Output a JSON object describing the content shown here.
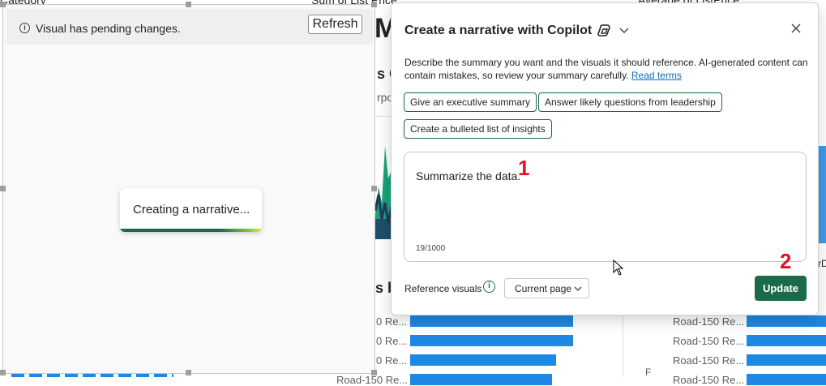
{
  "background": {
    "top_labels": [
      "Category",
      "Sum of List Price",
      "Average of ListPrice"
    ],
    "big_letter": "M",
    "card_title_fragments": [
      "s O",
      "s b"
    ],
    "card_sub_fragments": [
      "rpo",
      "rD"
    ],
    "bar_labels_left": [
      "0 Re...",
      "0 Re...",
      "0 Re...",
      "Road-150 Re..."
    ],
    "bar_labels_right": [
      "Road-150 Re...",
      "Road-150 Re...",
      "Road-150 Re...",
      "Road-150 Re..."
    ],
    "accent_bar_color": "#1e88e5"
  },
  "visual": {
    "pending_message": "Visual has pending changes.",
    "refresh_label": "Refresh",
    "loading_message": "Creating a narrative..."
  },
  "panel": {
    "title": "Create a narrative with Copilot",
    "description": "Describe the summary you want and the visuals it should reference. AI-generated content can contain mistakes, so review your summary carefully.",
    "read_terms_link": "Read terms",
    "suggestions": [
      "Give an executive summary",
      "Answer likely questions from leadership",
      "Create a bulleted list of insights"
    ],
    "prompt_value": "Summarize the data.",
    "char_count": "19/1000",
    "reference_label": "Reference visuals",
    "reference_selected": "Current page",
    "update_label": "Update",
    "accent_color": "#1b6b48"
  },
  "annotations": {
    "step1": "1",
    "step2": "2"
  }
}
